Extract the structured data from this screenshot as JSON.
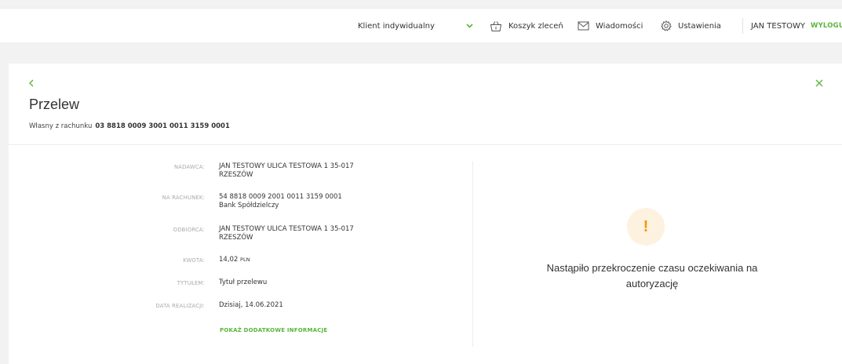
{
  "header": {
    "client_type": "Klient indywidualny",
    "cart_label": "Koszyk zleceń",
    "messages_label": "Wiadomości",
    "settings_label": "Ustawienia",
    "user_name": "JAN TESTOWY",
    "logout_label": "WYLOGUJ"
  },
  "colors": {
    "accent": "#5bb43a",
    "warning": "#f1980e",
    "warning_bg": "#fdf2df"
  },
  "page": {
    "title": "Przelew",
    "subtitle_prefix": "Własny z rachunku",
    "subtitle_account": "03 8818 0009 3001 0011 3159 0001"
  },
  "details": {
    "sender_label": "NADAWCA:",
    "sender_value": "JAN TESTOWY ULICA TESTOWA 1 35-017 RZESZÓW",
    "account_label": "NA RACHUNEK:",
    "account_number": "54 8818 0009 2001 0011 3159 0001",
    "account_bank": "Bank Spółdzielczy",
    "recipient_label": "ODBIORCA:",
    "recipient_value": "JAN TESTOWY ULICA TESTOWA 1 35-017 RZESZÓW",
    "amount_label": "KWOTA:",
    "amount_value": "14,02",
    "amount_currency": "PLN",
    "title_label": "TYTUŁEM:",
    "title_value": "Tytuł przelewu",
    "date_label": "DATA REALIZACJI:",
    "date_value": "Dzisiaj, 14.06.2021",
    "more_info": "POKAŻ DODATKOWE INFORMACJE"
  },
  "status": {
    "icon_glyph": "!",
    "message": "Nastąpiło przekroczenie czasu oczekiwania na autoryzację"
  }
}
